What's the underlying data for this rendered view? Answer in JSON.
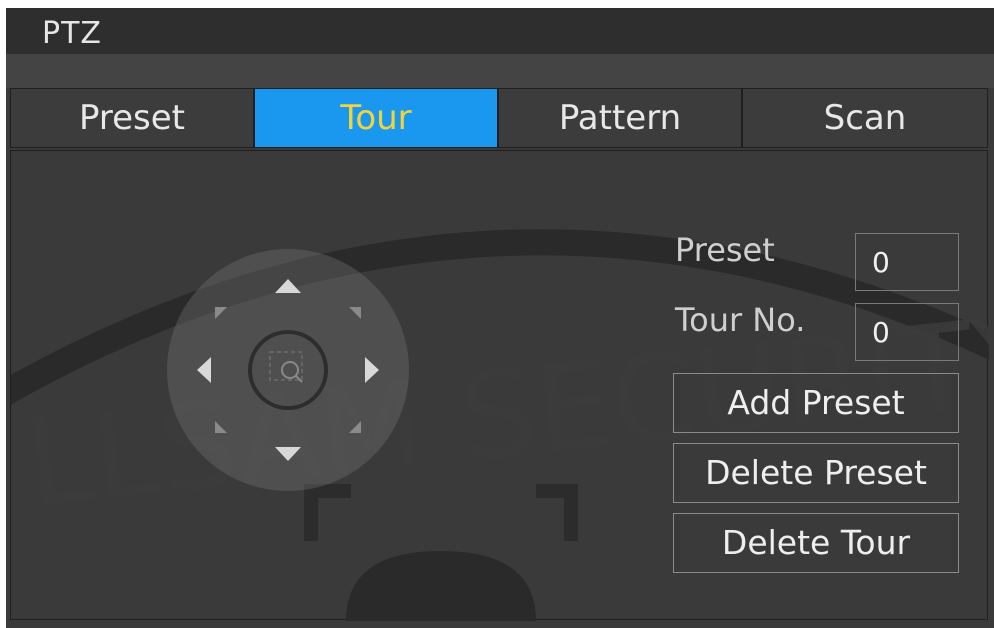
{
  "window": {
    "title": "PTZ"
  },
  "tabs": [
    {
      "label": "Preset",
      "active": false
    },
    {
      "label": "Tour",
      "active": true
    },
    {
      "label": "Pattern",
      "active": false
    },
    {
      "label": "Scan",
      "active": false
    }
  ],
  "form": {
    "preset_label": "Preset",
    "preset_value": "0",
    "tour_no_label": "Tour No.",
    "tour_no_value": "0"
  },
  "buttons": {
    "add_preset": "Add Preset",
    "delete_preset": "Delete Preset",
    "delete_tour": "Delete Tour"
  },
  "joystick": {
    "icons": [
      "up-arrow-icon",
      "down-arrow-icon",
      "left-arrow-icon",
      "right-arrow-icon",
      "zoom-area-icon"
    ]
  },
  "watermark": {
    "text": "LLSAM SECURITY"
  },
  "colors": {
    "active_tab_bg": "#1a98f0",
    "active_tab_text": "#f3d33a",
    "panel_bg": "#3a3a3a"
  }
}
